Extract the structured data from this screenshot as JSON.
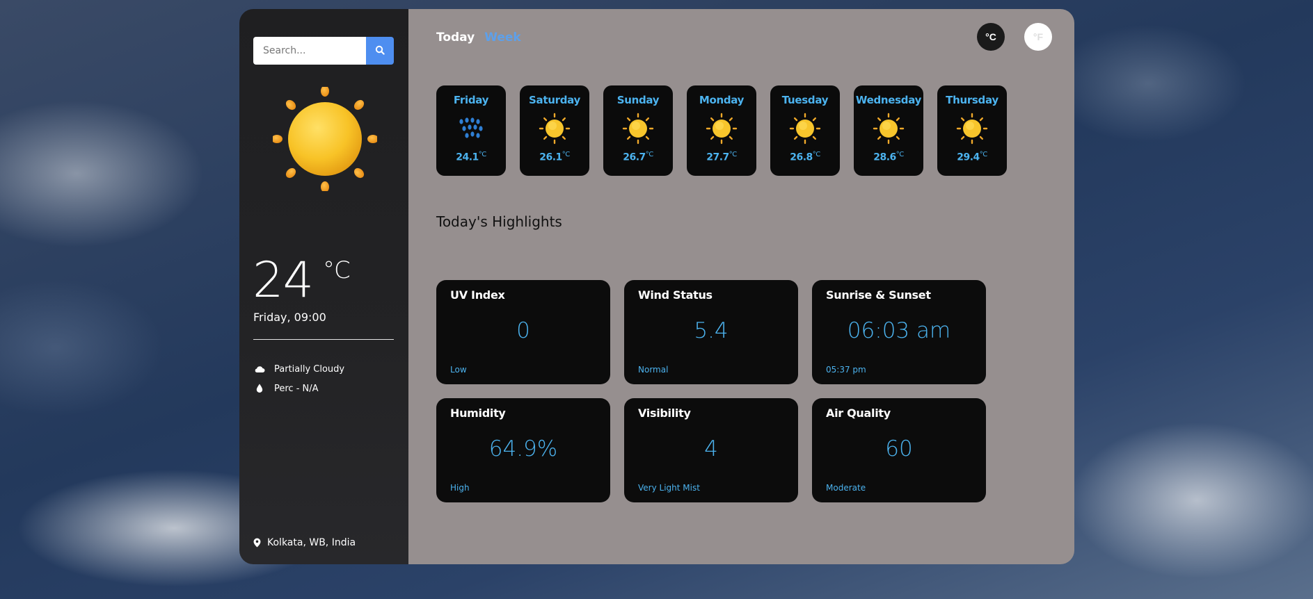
{
  "search": {
    "placeholder": "Search..."
  },
  "current": {
    "temp": "24",
    "unit": "°C",
    "day_time": "Friday, 09:00",
    "condition": "Partially Cloudy",
    "precipitation": "Perc - N/A",
    "location": "Kolkata, WB, India",
    "icon": "sun-icon"
  },
  "tabs": [
    {
      "label": "Today",
      "active": true
    },
    {
      "label": "Week",
      "active": false
    }
  ],
  "units": {
    "celsius": "°C",
    "fahrenheit": "°F"
  },
  "forecast": [
    {
      "day": "Friday",
      "temp": "24.1",
      "unit": "°C",
      "icon": "rain-icon"
    },
    {
      "day": "Saturday",
      "temp": "26.1",
      "unit": "°C",
      "icon": "sun-icon"
    },
    {
      "day": "Sunday",
      "temp": "26.7",
      "unit": "°C",
      "icon": "sun-icon"
    },
    {
      "day": "Monday",
      "temp": "27.7",
      "unit": "°C",
      "icon": "sun-icon"
    },
    {
      "day": "Tuesday",
      "temp": "26.8",
      "unit": "°C",
      "icon": "sun-icon"
    },
    {
      "day": "Wednesday",
      "temp": "28.6",
      "unit": "°C",
      "icon": "sun-icon"
    },
    {
      "day": "Thursday",
      "temp": "29.4",
      "unit": "°C",
      "icon": "sun-icon"
    }
  ],
  "highlights_title": "Today's Highlights",
  "highlights": [
    {
      "label": "UV Index",
      "value": "0",
      "sub": "Low"
    },
    {
      "label": "Wind Status",
      "value": "5.4",
      "sub": "Normal"
    },
    {
      "label": "Sunrise & Sunset",
      "value": "06:03 am",
      "sub": "05:37 pm"
    },
    {
      "label": "Humidity",
      "value": "64.9%",
      "sub": "High"
    },
    {
      "label": "Visibility",
      "value": "4",
      "sub": "Very Light Mist"
    },
    {
      "label": "Air Quality",
      "value": "60",
      "sub": "Moderate"
    }
  ],
  "colors": {
    "accent": "#4cb3ef",
    "tab_inactive": "#5da0ea",
    "search_button": "#4e8ef0",
    "main_bg": "#968f8f",
    "sidebar_bg": "#202022",
    "card_bg": "#0b0b0b"
  }
}
